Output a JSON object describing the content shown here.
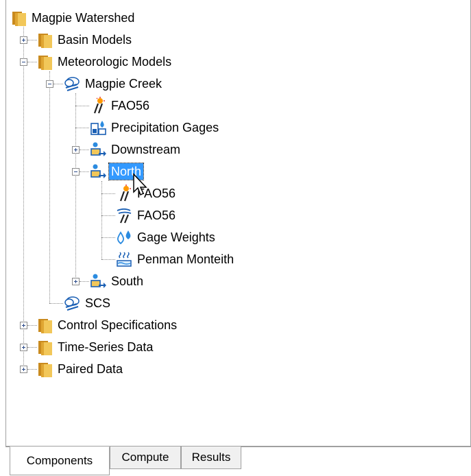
{
  "tree": {
    "root": "Magpie Watershed",
    "basin_models": "Basin Models",
    "meteorologic_models": "Meteorologic Models",
    "magpie_creek": "Magpie Creek",
    "fao56_top": "FAO56",
    "precipitation_gages": "Precipitation Gages",
    "downstream": "Downstream",
    "north": "North",
    "north_fao56_a": "FAO56",
    "north_fao56_b": "FAO56",
    "gage_weights": "Gage Weights",
    "penman_monteith": "Penman Monteith",
    "south": "South",
    "scs": "SCS",
    "control_specifications": "Control Specifications",
    "time_series_data": "Time-Series Data",
    "paired_data": "Paired Data"
  },
  "tabs": {
    "components": "Components",
    "compute": "Compute",
    "results": "Results"
  },
  "colors": {
    "selection": "#3399ff",
    "folder": "#e8b84a"
  }
}
